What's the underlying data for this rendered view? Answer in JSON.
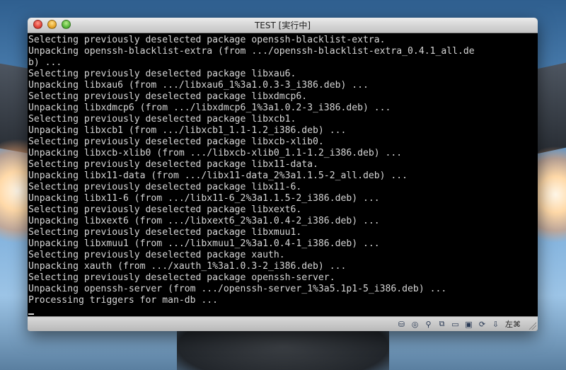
{
  "window": {
    "title": "TEST [実行中]"
  },
  "console": {
    "lines": [
      "Selecting previously deselected package openssh-blacklist-extra.",
      "Unpacking openssh-blacklist-extra (from .../openssh-blacklist-extra_0.4.1_all.de",
      "b) ...",
      "Selecting previously deselected package libxau6.",
      "Unpacking libxau6 (from .../libxau6_1%3a1.0.3-3_i386.deb) ...",
      "Selecting previously deselected package libxdmcp6.",
      "Unpacking libxdmcp6 (from .../libxdmcp6_1%3a1.0.2-3_i386.deb) ...",
      "Selecting previously deselected package libxcb1.",
      "Unpacking libxcb1 (from .../libxcb1_1.1-1.2_i386.deb) ...",
      "Selecting previously deselected package libxcb-xlib0.",
      "Unpacking libxcb-xlib0 (from .../libxcb-xlib0_1.1-1.2_i386.deb) ...",
      "Selecting previously deselected package libx11-data.",
      "Unpacking libx11-data (from .../libx11-data_2%3a1.1.5-2_all.deb) ...",
      "Selecting previously deselected package libx11-6.",
      "Unpacking libx11-6 (from .../libx11-6_2%3a1.1.5-2_i386.deb) ...",
      "Selecting previously deselected package libxext6.",
      "Unpacking libxext6 (from .../libxext6_2%3a1.0.4-2_i386.deb) ...",
      "Selecting previously deselected package libxmuu1.",
      "Unpacking libxmuu1 (from .../libxmuu1_2%3a1.0.4-1_i386.deb) ...",
      "Selecting previously deselected package xauth.",
      "Unpacking xauth (from .../xauth_1%3a1.0.3-2_i386.deb) ...",
      "Selecting previously deselected package openssh-server.",
      "Unpacking openssh-server (from .../openssh-server_1%3a5.1p1-5_i386.deb) ...",
      "Processing triggers for man-db ..."
    ]
  },
  "statusbar": {
    "icons": [
      {
        "name": "hard-disk-icon",
        "glyph": "⛁"
      },
      {
        "name": "cd-dvd-icon",
        "glyph": "◎"
      },
      {
        "name": "usb-icon",
        "glyph": "⚲"
      },
      {
        "name": "network-icon",
        "glyph": "⧉"
      },
      {
        "name": "shared-folder-icon",
        "glyph": "▭"
      },
      {
        "name": "display-icon",
        "glyph": "▣"
      },
      {
        "name": "virtualization-icon",
        "glyph": "⟳"
      },
      {
        "name": "mouse-integration-icon",
        "glyph": "⇩"
      }
    ],
    "host_key": "左⌘"
  },
  "colors": {
    "console_bg": "#000000",
    "console_fg": "#d6d6d6"
  }
}
